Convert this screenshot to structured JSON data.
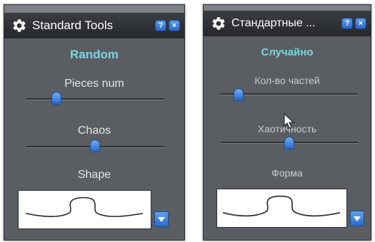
{
  "left_panel": {
    "title": "Standard Tools",
    "help_button": "?",
    "close_button": "×",
    "mode_heading": "Random",
    "pieces_label": "Pieces num",
    "pieces_value": 0.22,
    "chaos_label": "Chaos",
    "chaos_value": 0.5,
    "shape_label": "Shape"
  },
  "right_panel": {
    "title": "Стандартные ...",
    "help_button": "?",
    "close_button": "×",
    "mode_heading": "Случайно",
    "pieces_label": "Кол-во частей",
    "pieces_value": 0.13,
    "chaos_label": "Хаотичность",
    "chaos_value": 0.5,
    "shape_label": "Форма"
  },
  "icons": {
    "title_icon": "gear-icon",
    "dropdown_icon": "triangle-down-icon",
    "cursor_icon": "mouse-pointer-icon"
  },
  "colors": {
    "panel_bg": "#5a5d62",
    "heading": "#79d6e2",
    "accent_blue": "#2a67c4"
  }
}
